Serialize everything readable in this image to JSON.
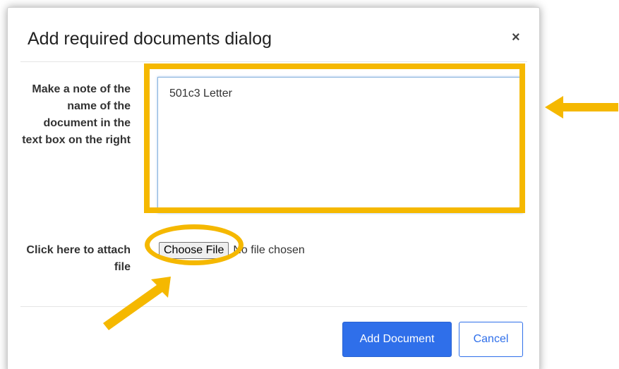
{
  "dialog": {
    "title": "Add required documents dialog",
    "close_glyph": "×"
  },
  "note_field": {
    "label": "Make a note of the name of the document in the text box on the right",
    "value": "501c3 Letter"
  },
  "attach_field": {
    "label": "Click here to attach file",
    "button_label": "Choose File",
    "status": "No file chosen"
  },
  "footer": {
    "add_label": "Add Document",
    "cancel_label": "Cancel"
  },
  "colors": {
    "annotation": "#f5b800",
    "primary": "#2f6fea"
  },
  "icons": {
    "close": "close-icon",
    "resize": "resize-grip-icon",
    "annotation_arrows": "arrow-icon"
  }
}
